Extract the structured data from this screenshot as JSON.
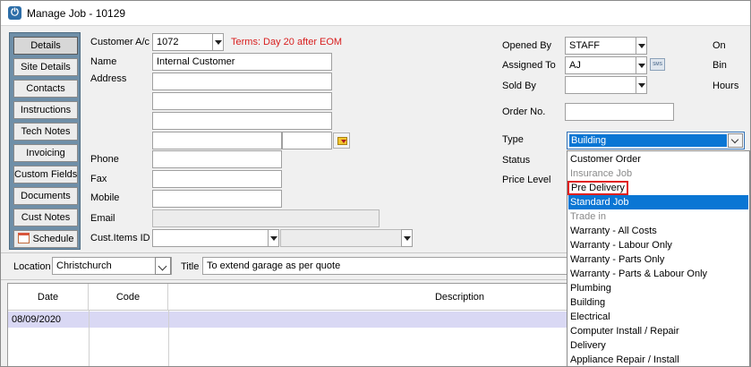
{
  "window": {
    "title": "Manage Job - 10129",
    "icon": "power-icon"
  },
  "nav": {
    "items": [
      {
        "label": "Details",
        "active": true
      },
      {
        "label": "Site Details"
      },
      {
        "label": "Contacts"
      },
      {
        "label": "Instructions"
      },
      {
        "label": "Tech Notes"
      },
      {
        "label": "Invoicing"
      },
      {
        "label": "Custom Fields"
      },
      {
        "label": "Documents"
      },
      {
        "label": "Cust Notes"
      },
      {
        "label": "Schedule",
        "icon": "calendar-icon"
      }
    ]
  },
  "customer": {
    "account_label": "Customer A/c",
    "account_value": "1072",
    "terms": "Terms: Day 20 after EOM",
    "name_label": "Name",
    "name_value": "Internal Customer",
    "address_label": "Address",
    "phone_label": "Phone",
    "fax_label": "Fax",
    "mobile_label": "Mobile",
    "email_label": "Email",
    "cust_items_label": "Cust.Items ID"
  },
  "job": {
    "opened_by_label": "Opened By",
    "opened_by_value": "STAFF",
    "assigned_to_label": "Assigned To",
    "assigned_to_value": "AJ",
    "sold_by_label": "Sold By",
    "order_no_label": "Order No.",
    "type_label": "Type",
    "type_value": "Building",
    "status_label": "Status",
    "price_level_label": "Price Level",
    "on_label": "On",
    "bin_label": "Bin",
    "hours_label": "Hours",
    "sms_icon_text": "SMS"
  },
  "location": {
    "label": "Location",
    "value": "Christchurch",
    "title_label": "Title",
    "title_value": "To extend garage as per quote"
  },
  "grid": {
    "columns": [
      "Date",
      "Code",
      "Description"
    ],
    "rows": [
      {
        "date": "08/09/2020",
        "code": "",
        "description": ""
      }
    ]
  },
  "type_options": [
    {
      "label": "Customer Order"
    },
    {
      "label": "Insurance Job",
      "disabled": true
    },
    {
      "label": "Pre Delivery",
      "highlighted": true
    },
    {
      "label": "Standard Job",
      "selected": true
    },
    {
      "label": "Trade in",
      "disabled": true
    },
    {
      "label": "Warranty - All Costs"
    },
    {
      "label": "Warranty - Labour Only"
    },
    {
      "label": "Warranty - Parts Only"
    },
    {
      "label": "Warranty - Parts & Labour Only"
    },
    {
      "label": "Plumbing"
    },
    {
      "label": "Building"
    },
    {
      "label": "Electrical"
    },
    {
      "label": "Computer Install / Repair"
    },
    {
      "label": "Delivery"
    },
    {
      "label": "Appliance Repair / Install"
    }
  ],
  "colors": {
    "selection": "#0a76d4",
    "terms_text": "#d81e1e",
    "nav_panel": "#6f8fa8",
    "grid_row": "#d9d8f4"
  }
}
